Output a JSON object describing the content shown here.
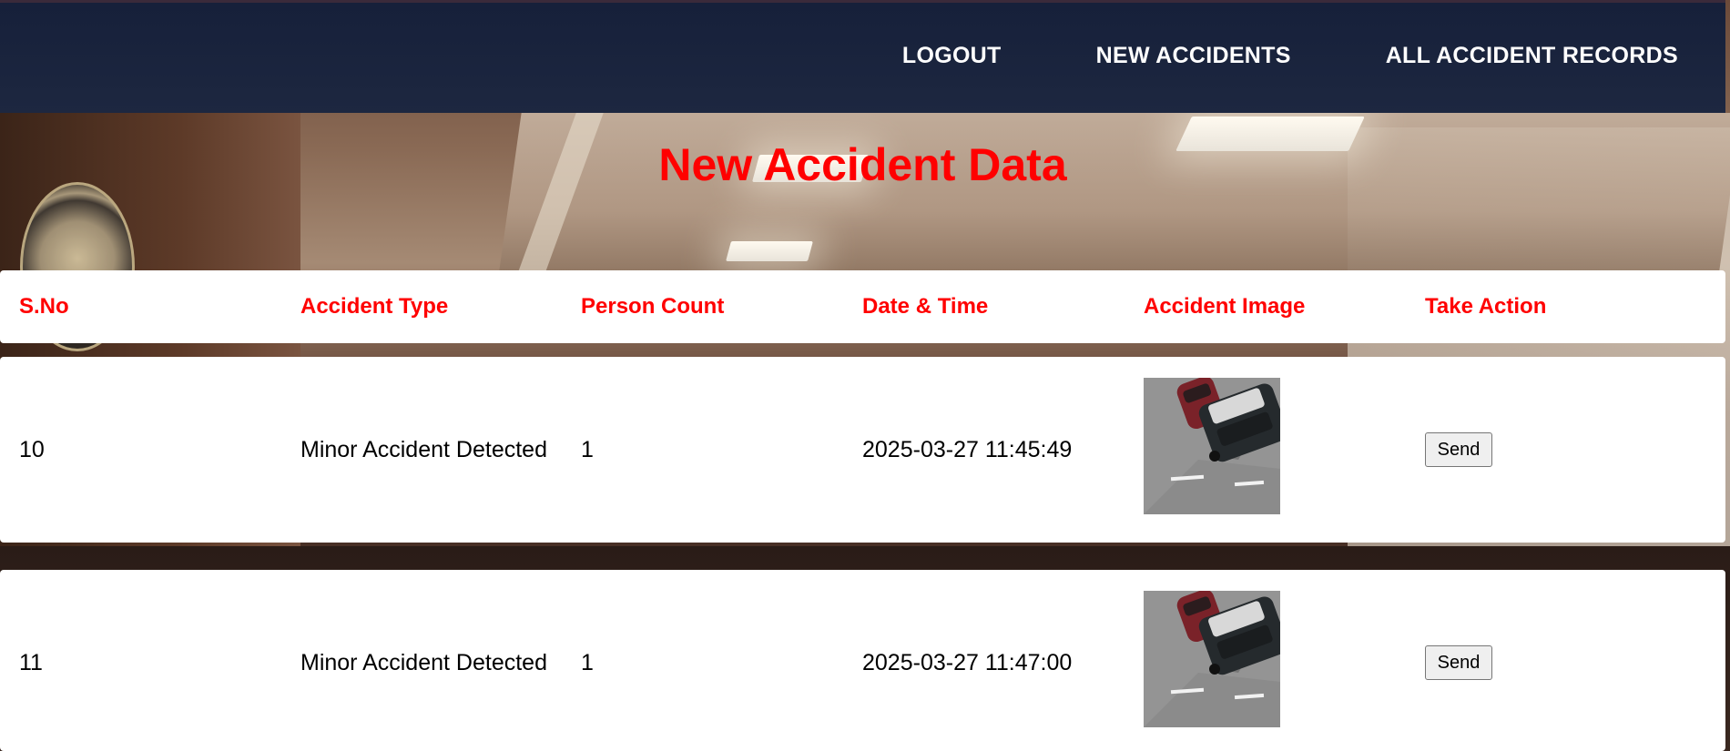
{
  "nav": {
    "logout": "LOGOUT",
    "new_accidents": "NEW ACCIDENTS",
    "all_records": "ALL ACCIDENT RECORDS"
  },
  "page": {
    "title": "New Accident Data"
  },
  "table": {
    "headers": [
      "S.No",
      "Accident Type",
      "Person Count",
      "Date & Time",
      "Accident Image",
      "Take Action"
    ],
    "rows": [
      {
        "sno": "10",
        "type": "Minor Accident Detected",
        "count": "1",
        "datetime": "2025-03-27 11:45:49",
        "image": "accident-photo",
        "action": "Send"
      },
      {
        "sno": "11",
        "type": "Minor Accident Detected",
        "count": "1",
        "datetime": "2025-03-27 11:47:00",
        "image": "accident-photo",
        "action": "Send"
      }
    ]
  },
  "colors": {
    "accent": "#ff0000",
    "navbar": "#1b2540"
  }
}
